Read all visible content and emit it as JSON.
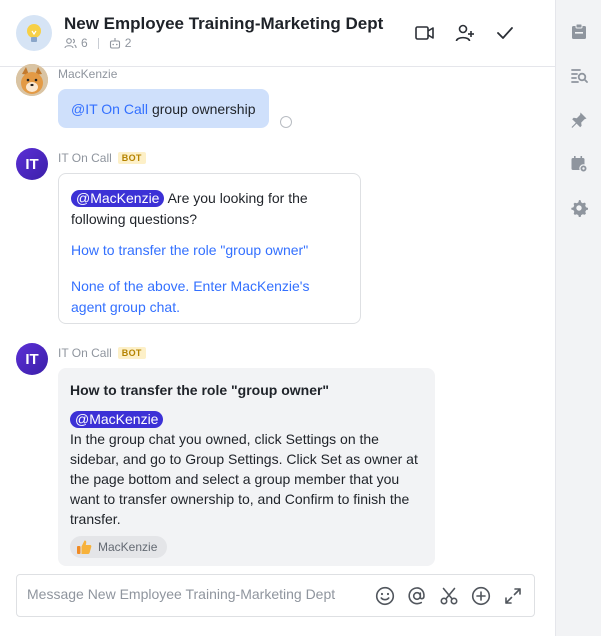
{
  "header": {
    "title": "New Employee Training-Marketing Dept",
    "member_count": "6",
    "bot_count": "2"
  },
  "messages": [
    {
      "sender": "MacKenzie",
      "mention": "@IT On Call",
      "text": "group ownership"
    },
    {
      "sender": "IT On Call",
      "badge": "BOT",
      "avatar_text": "IT",
      "mention": "@MacKenzie",
      "text": "Are you looking for the following questions?",
      "options": [
        "How to transfer the role \"group owner\"",
        "None of the above. Enter MacKenzie's agent group chat."
      ]
    },
    {
      "sender": "IT On Call",
      "badge": "BOT",
      "avatar_text": "IT",
      "question": "How to transfer the role \"group owner\"",
      "mention": "@MacKenzie",
      "answer": "In the group chat you owned, click Settings on the sidebar, and go to Group Settings. Click Set as owner at the page bottom and select a group member that you want to transfer ownership to, and Confirm to finish the transfer.",
      "reaction_user": "MacKenzie",
      "reaction_icon": "thumbs-up-icon"
    }
  ],
  "composer": {
    "placeholder": "Message New Employee Training-Marketing Dept"
  },
  "colors": {
    "accent": "#3370ff",
    "mention_pill": "#3c31d6",
    "self_bubble": "#cfe0fb",
    "bot_badge_bg": "#fdf0c8"
  }
}
